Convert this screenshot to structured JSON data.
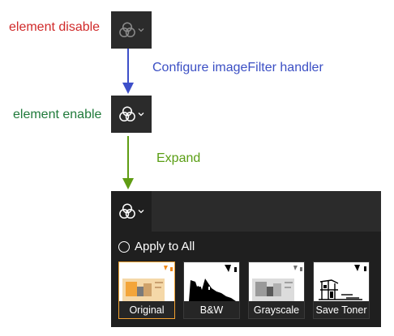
{
  "annotations": {
    "element_disable": "element disable",
    "configure": "Configure imageFilter handler",
    "element_enable": "element enable",
    "expand": "Expand"
  },
  "colors": {
    "disable_text": "#d02a2a",
    "configure_text": "#3b4fc4",
    "enable_text": "#1f7a3a",
    "expand_text": "#5a9e14",
    "arrow1": "#3d4fc9",
    "arrow2": "#5f9c13",
    "selected_border": "#f0a030"
  },
  "icons": {
    "filter": "image-filter-icon",
    "dropdown": "chevron-down-icon"
  },
  "panel": {
    "apply_label": "Apply to All",
    "filters": [
      {
        "label": "Original",
        "selected": true
      },
      {
        "label": "B&W",
        "selected": false
      },
      {
        "label": "Grayscale",
        "selected": false
      },
      {
        "label": "Save Toner",
        "selected": false
      }
    ]
  }
}
